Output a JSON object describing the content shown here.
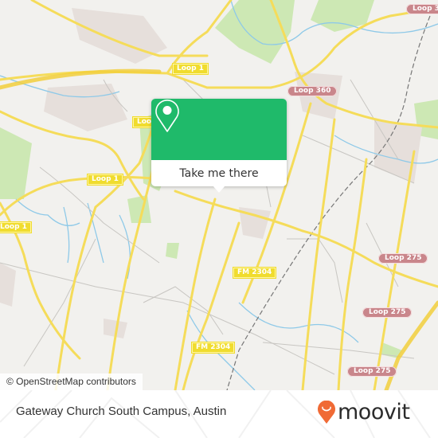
{
  "map": {
    "colors": {
      "background": "#f2f1ee",
      "highway": "#f5dc5a",
      "road_minor": "#c8c6c2",
      "water": "#8ec9e8",
      "park": "#cde8b4",
      "urban": "#e6dfdb",
      "rail": "#777777"
    },
    "road_labels": [
      {
        "id": "loop1-a",
        "text": "Loop 1",
        "style": "yellow"
      },
      {
        "id": "loop1-b",
        "text": "Loop",
        "style": "yellow"
      },
      {
        "id": "loop1-c",
        "text": "Loop 1",
        "style": "yellow"
      },
      {
        "id": "loop1-d",
        "text": "Loop 1",
        "style": "yellow"
      },
      {
        "id": "loop360-a",
        "text": "Loop 360",
        "style": "red"
      },
      {
        "id": "loop360-b",
        "text": "Loop 3",
        "style": "red"
      },
      {
        "id": "fm2304-a",
        "text": "FM 2304",
        "style": "yellow"
      },
      {
        "id": "fm2304-b",
        "text": "FM 2304",
        "style": "yellow"
      },
      {
        "id": "loop275-a",
        "text": "Loop 275",
        "style": "red"
      },
      {
        "id": "loop275-b",
        "text": "Loop 275",
        "style": "red"
      },
      {
        "id": "loop275-c",
        "text": "Loop 275",
        "style": "red"
      }
    ],
    "popup": {
      "icon": "map-pin-icon",
      "button_label": "Take me there",
      "accent": "#1fba6a"
    },
    "attribution": "© OpenStreetMap contributors"
  },
  "footer": {
    "place_name": "Gateway Church South Campus, Austin",
    "brand": {
      "name": "moovit",
      "icon": "moovit-pin-smile-icon",
      "color": "#f06a35"
    }
  }
}
